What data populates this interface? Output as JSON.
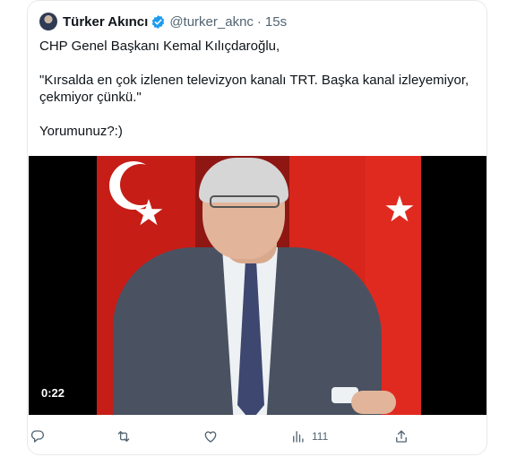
{
  "tweet": {
    "author_name": "Türker Akıncı",
    "handle": "@turker_aknc",
    "separator": "·",
    "time": "15s",
    "text_lines": [
      "CHP Genel Başkanı Kemal Kılıçdaroğlu,",
      "\"Kırsalda en çok izlenen televizyon kanalı TRT. Başka kanal izleyemiyor,",
      "çekmiyor çünkü.\"",
      "Yorumunuz?:)"
    ],
    "media": {
      "duration": "0:22"
    },
    "actions": {
      "reply_icon": "reply-icon",
      "retweet_icon": "retweet-icon",
      "like_icon": "heart-icon",
      "views_icon": "views-icon",
      "views_count": "111",
      "share_icon": "share-icon"
    }
  },
  "colors": {
    "verified": "#1d9bf0",
    "secondary_text": "#536471",
    "primary_text": "#0f1419"
  }
}
